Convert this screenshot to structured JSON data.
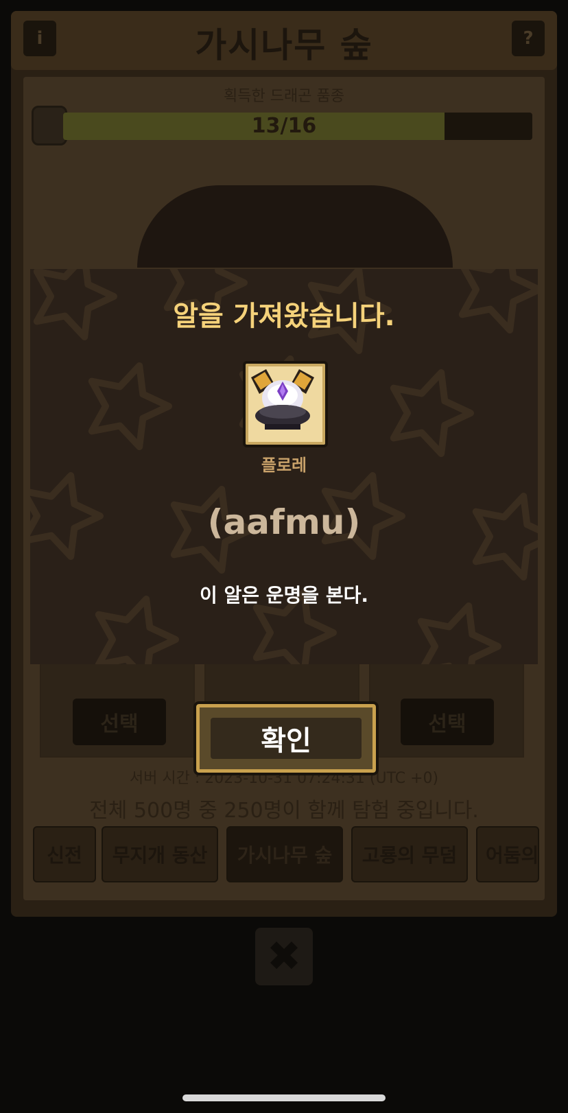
{
  "header": {
    "title": "가시나무 숲",
    "info_icon": "i",
    "help_icon": "?"
  },
  "progress": {
    "label": "획득한 드래곤 품종",
    "text": "13/16",
    "value": 13,
    "max": 16
  },
  "cards": {
    "select_label_left": "선택",
    "select_label_right": "선택"
  },
  "footer": {
    "server_time": "서버 시간 : 2023-10-31 07:24:31 (UTC +0)",
    "explore_status": "전체 500명 중 250명이 함께 탐험 중입니다."
  },
  "zone_tabs": [
    {
      "label": "신전"
    },
    {
      "label": "무지개 동산"
    },
    {
      "label": "가시나무 숲",
      "active": true
    },
    {
      "label": "고룡의 무덤"
    },
    {
      "label": "어둠의"
    }
  ],
  "close_icon": "✖",
  "modal": {
    "title": "알을 가져왔습니다.",
    "egg_name": "플로레",
    "egg_code": "(aafmu)",
    "description": "이 알은 운명을 본다.",
    "confirm_label": "확인"
  },
  "colors": {
    "title_gold": "#f5d27a",
    "egg_name": "#c9a26a",
    "egg_code": "#ccb79b",
    "modal_bg": "#2a2018",
    "button_border": "#c9a14e"
  }
}
